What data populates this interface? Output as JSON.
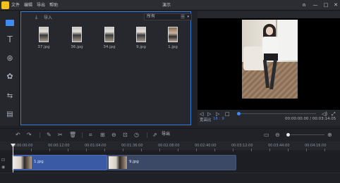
{
  "app": {
    "menu": [
      "文件",
      "编辑",
      "导出",
      "帮助"
    ],
    "window_title": "演示",
    "controls": {
      "user": "⍝",
      "minimize": "—",
      "maximize": "□",
      "close": "✕"
    }
  },
  "sidebar": {
    "items": [
      {
        "name": "media-tab",
        "glyph": ""
      },
      {
        "name": "text-tab",
        "glyph": "T"
      },
      {
        "name": "filters-tab",
        "glyph": "⊛"
      },
      {
        "name": "overlays-tab",
        "glyph": "✿"
      },
      {
        "name": "transitions-tab",
        "glyph": "⇆"
      },
      {
        "name": "elements-tab",
        "glyph": "▤"
      }
    ]
  },
  "media": {
    "import_label": "导入",
    "filter_value": "所有",
    "items": [
      {
        "file": "37.jpg"
      },
      {
        "file": "36.jpg"
      },
      {
        "file": "34.jpg"
      },
      {
        "file": "9.jpg"
      },
      {
        "file": "1.jpg"
      }
    ]
  },
  "preview": {
    "ratio_label": "宽高比",
    "ratio_value": "16 : 9",
    "timecode": "00:00:00.00 / 00:03:14.05",
    "progress": 0.0
  },
  "toolbar": {
    "export_label": "导出"
  },
  "ruler": {
    "labels": [
      "00:00:00:00",
      "00:00:12:00",
      "00:01:04:00",
      "00:01:36:00",
      "00:02:08:00",
      "00:02:40:00",
      "00:03:12:00",
      "00:03:44:00",
      "00:04:16:00"
    ]
  },
  "timeline": {
    "clips": [
      {
        "label": "1.jpg"
      },
      {
        "label": "9.jpg"
      }
    ]
  },
  "colors": {
    "accent": "#3f8cf0",
    "panel": "#26282e",
    "background": "#202228",
    "clip_selected": "#3a5aa6",
    "logo": "#f3c11c"
  }
}
